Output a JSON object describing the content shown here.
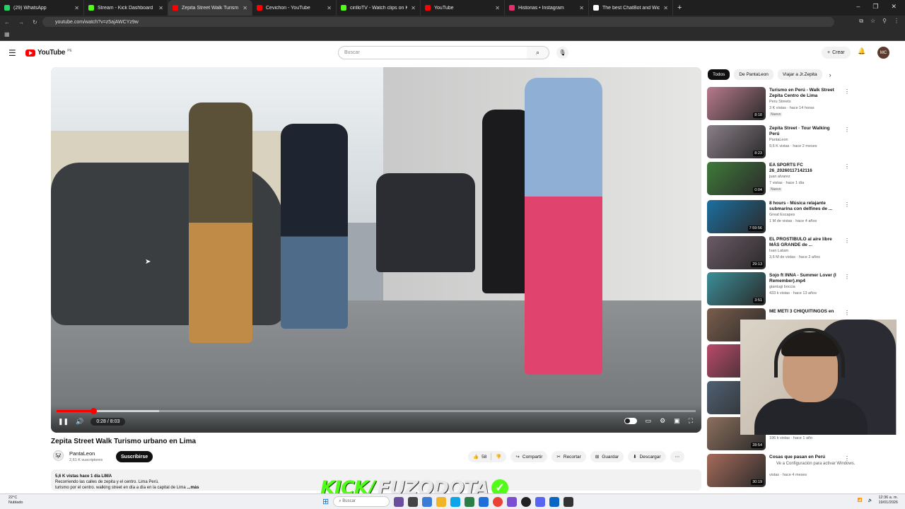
{
  "browser": {
    "tabs": [
      {
        "title": "(29) WhatsApp",
        "color": "#25d366"
      },
      {
        "title": "Stream - Kick Dashboard",
        "color": "#53fc18"
      },
      {
        "title": "Zepita Street Walk Turism",
        "color": "#ff0000"
      },
      {
        "title": "Cevichon - YouTube",
        "color": "#ff0000"
      },
      {
        "title": "cirilloTV - Watch clips on Kick",
        "color": "#53fc18"
      },
      {
        "title": "YouTube",
        "color": "#ff0000"
      },
      {
        "title": "Historias • Instagram",
        "color": "#e1306c"
      },
      {
        "title": "The best ChatBot and Widget",
        "color": "#ffffff"
      }
    ],
    "new_tab": "+",
    "url": "youtube.com/watch?v=z5ajAWCYz9w"
  },
  "youtube": {
    "logo_text": "YouTube",
    "logo_country": "PE",
    "search_placeholder": "Buscar",
    "create_label": "Crear",
    "avatar_initials": "MC"
  },
  "player": {
    "current_time": "0:28",
    "duration": "8:03",
    "time_display": "0:28 / 8:03",
    "progress": 0.058,
    "buffered": 0.16
  },
  "video": {
    "title": "Zepita Street Walk Turismo urbano en Lima",
    "channel": "PantaLeon",
    "subscribers": "2,61 K suscriptores",
    "subscribe_label": "Suscribirse",
    "likes": "58",
    "share_label": "Compartir",
    "clip_label": "Recortar",
    "save_label": "Guardar",
    "download_label": "Descargar",
    "description_meta": "5,6 K vistas  hace 1 día  LIMA",
    "description_line1": "Recorriendo las calles de zepita y el centro. Lima Perú.",
    "description_line2": "turismo por el centro. walking street en día a día en la capital de Lima",
    "description_more": "...más"
  },
  "sidebar": {
    "chips": [
      "Todos",
      "De PantaLeon",
      "Viajar a Jr.Zepita"
    ],
    "recommendations": [
      {
        "title": "Turismo en Perú - Walk Street Zepita Centro de Lima",
        "channel": "Peru Streets",
        "meta": "3 K vistas · hace 14 horas",
        "badge": "Nuevo",
        "duration": "8:18",
        "color": "#b87a8c"
      },
      {
        "title": "Zepita Street · Tour Walking Perú",
        "channel": "PantaLeon",
        "meta": "9,6 K vistas · hace 2 meses",
        "badge": "",
        "duration": "8:23",
        "color": "#8a7f88"
      },
      {
        "title": "EA SPORTS FC 26_20260117142116",
        "channel": "juan alvarez",
        "meta": "7 vistas · hace 1 día",
        "badge": "Nuevo",
        "duration": "0:04",
        "color": "#3f7a3a"
      },
      {
        "title": "8 hours - Música relajante submarina con delfines de ...",
        "channel": "Great Escapes",
        "meta": "1 M de vistas · hace 4 años",
        "badge": "",
        "duration": "7:59:56",
        "color": "#1c6fa0"
      },
      {
        "title": "EL PROSTÍBULO al aire libre MÁS GRANDE de ...",
        "channel": "Ivan Latam",
        "meta": "3,6 M de vistas · hace 2 años",
        "badge": "",
        "duration": "29:13",
        "color": "#6c5a66"
      },
      {
        "title": "Sojo ft INNA - Summer Lover (I Remember).mp4",
        "channel": "giantugi boccia",
        "meta": "433 k vistas · hace 13 años",
        "badge": "",
        "duration": "3:51",
        "color": "#3b8f98"
      },
      {
        "title": "ME METÍ 3 CHIQUITINGOS en",
        "channel": "",
        "meta": "",
        "badge": "",
        "duration": "",
        "color": "#7a5d4c"
      },
      {
        "title": "",
        "channel": "",
        "meta": "",
        "badge": "",
        "duration": "",
        "color": "#b94a6a"
      },
      {
        "title": "",
        "channel": "",
        "meta": "",
        "badge": "",
        "duration": "",
        "color": "#506072"
      },
      {
        "title": "",
        "channel": "",
        "meta": "196 k vistas · hace 1 año",
        "badge": "",
        "duration": "28:54",
        "color": "#8c6f5e"
      },
      {
        "title": "Cosas que pasan en Perú",
        "channel": "",
        "meta": "vistas · hace 4 meses",
        "badge": "",
        "duration": "30:19",
        "color": "#a66b5a"
      }
    ]
  },
  "overlay": {
    "kick_text": "KICK/",
    "kick_name": "FUZODOTA",
    "activate_windows": "Ve a Configuración para activar Windows."
  },
  "taskbar": {
    "weather_temp": "22°C",
    "weather_desc": "Nublado",
    "search_placeholder": "Buscar",
    "time": "12:36 a. m.",
    "date": "19/01/2026"
  }
}
